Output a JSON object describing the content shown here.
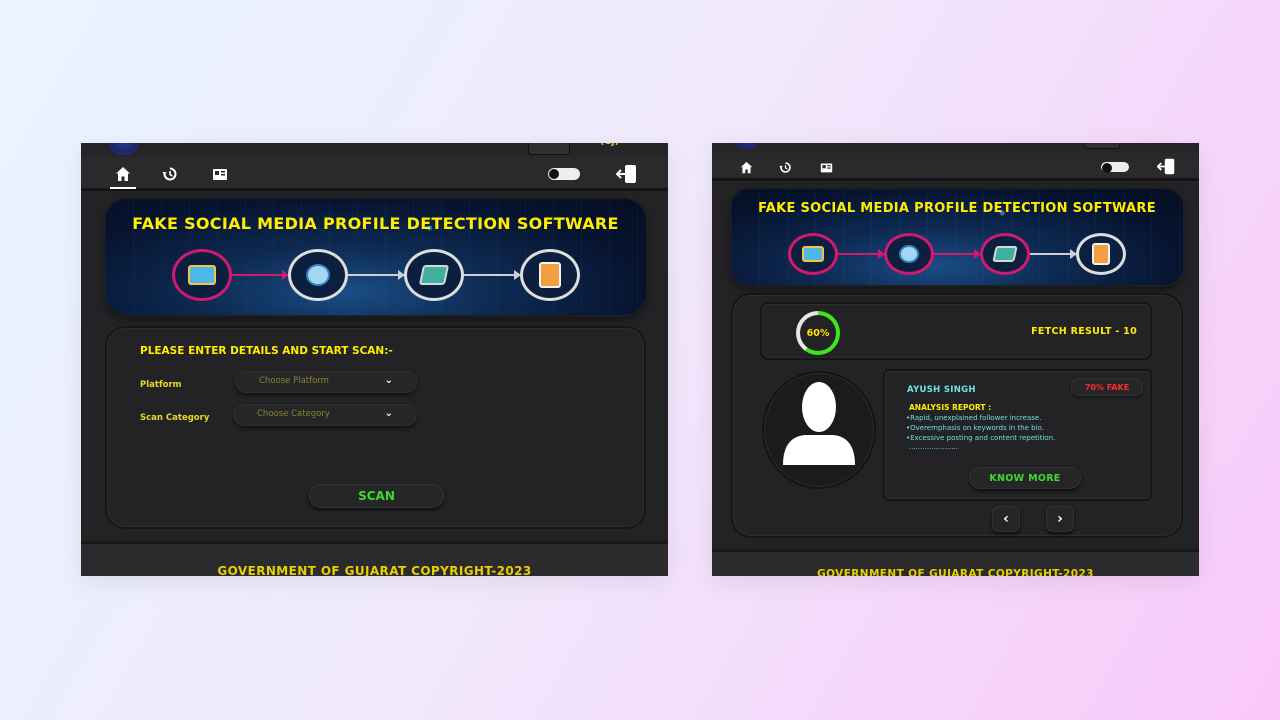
{
  "scan_screen": {
    "banner_title": "FAKE SOCIAL MEDIA PROFILE DETECTION SOFTWARE",
    "form_heading": "PLEASE ENTER DETAILS AND START SCAN:-",
    "platform_label": "Platform",
    "platform_placeholder": "Choose Platform",
    "category_label": "Scan Category",
    "category_placeholder": "Choose Category",
    "scan_button": "SCAN",
    "footer": "GOVERNMENT OF GUJARAT COPYRIGHT-2023"
  },
  "result_screen": {
    "banner_title": "FAKE SOCIAL MEDIA PROFILE DETECTION SOFTWARE",
    "progress_label": "60%",
    "progress_value": 0.6,
    "fetch_result": "FETCH RESULT  -  10",
    "profile_name": "AYUSH SINGH",
    "fake_badge": "70% FAKE",
    "report_title": "ANALYSIS REPORT :",
    "report_lines": [
      "•Rapid, unexplained follower increase.",
      "•Overemphasis on keywords in the bio.",
      "•Excessive posting and content repetition.",
      "......................"
    ],
    "know_more": "KNOW MORE",
    "footer": "GOVERNMENT OF GUJARAT COPYRIGHT-2023"
  },
  "nav_icons": [
    "home-icon",
    "history-icon",
    "report-icon"
  ],
  "colors": {
    "accent_yellow": "#ffee00",
    "accent_green": "#3cdc2a",
    "fake_red": "#ff2a2a",
    "panel_bg": "#232325",
    "flow_magenta": "#d01a6f"
  }
}
